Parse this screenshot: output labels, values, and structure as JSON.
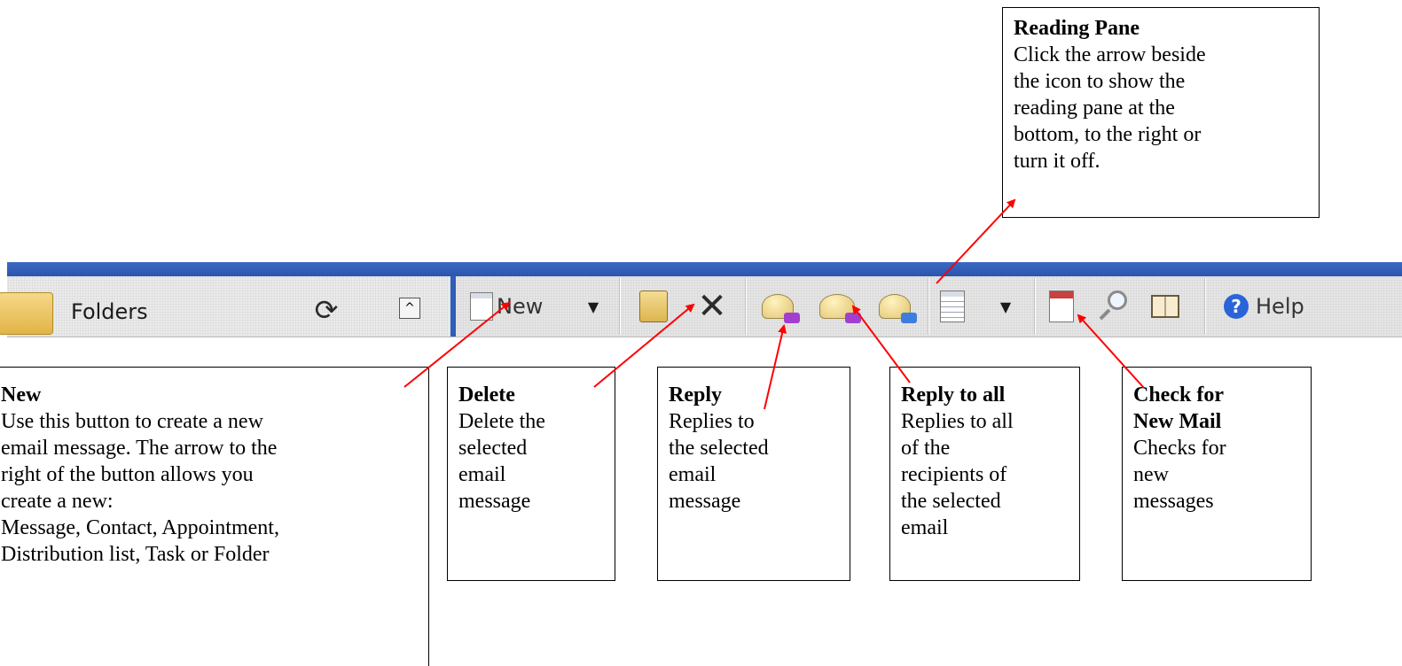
{
  "toolbar": {
    "folders_label": "Folders",
    "new_label": "New",
    "help_label": "Help",
    "help_glyph": "?",
    "sync_glyph": "⟳",
    "collapse_glyph": "^",
    "dropdown_glyph": "▼",
    "delete_glyph": "✕",
    "icons": {
      "folders": "folder-icon",
      "sync": "sync-icon",
      "collapse": "collapse-up-icon",
      "new": "new-mail-icon",
      "move_to_folder": "move-to-folder-icon",
      "delete": "delete-icon",
      "reply": "reply-icon",
      "reply_all": "reply-all-icon",
      "forward": "forward-icon",
      "reading_pane": "reading-pane-icon",
      "check_mail": "check-mail-icon",
      "find": "find-icon",
      "address_book": "address-book-icon",
      "help": "help-icon"
    }
  },
  "callouts": {
    "reading_pane": {
      "title": "Reading Pane",
      "body": "Click the arrow beside\nthe icon to show the\nreading pane at the\nbottom, to the right or\nturn it off."
    },
    "new": {
      "title": "New",
      "body": "Use this button to create a new\nemail message. The arrow to the\nright of the button allows you\ncreate a new:\nMessage, Contact, Appointment,\nDistribution list, Task or Folder"
    },
    "delete": {
      "title": "Delete",
      "body": "Delete the\nselected\nemail\nmessage"
    },
    "reply": {
      "title": "Reply",
      "body": "Replies to\nthe selected\nemail\nmessage"
    },
    "reply_all": {
      "title": "Reply to all",
      "body": "Replies to all\nof the\nrecipients of\nthe selected\nemail"
    },
    "check_mail": {
      "title": "Check for\nNew Mail",
      "body": "Checks for\nnew\nmessages"
    }
  },
  "colors": {
    "arrow": "#ff0000",
    "toolbar_blue": "#2f5eb8",
    "toolbar_bg": "#e6e6e6"
  }
}
